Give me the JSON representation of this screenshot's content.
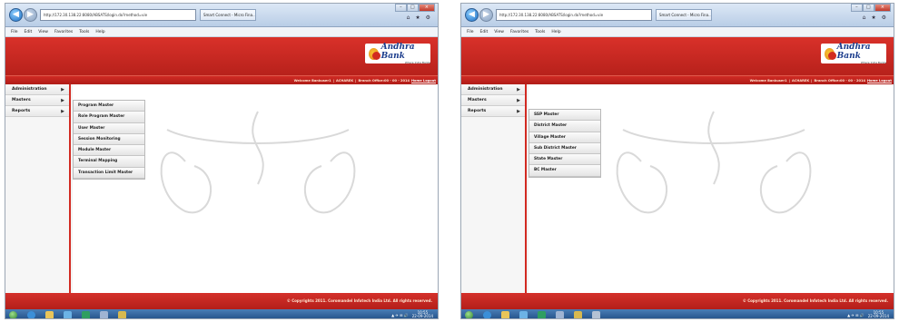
{
  "browser": {
    "address": "http://172.30.138.22:8080/ABSATS/login.do?method=vie",
    "tab_title": "Smart Connect - Micro Fina...",
    "menu": [
      "File",
      "Edit",
      "View",
      "Favorites",
      "Tools",
      "Help"
    ]
  },
  "header": {
    "logo_name": "Andhra Bank",
    "logo_tagline": "Where India Banks"
  },
  "welcome": {
    "greeting": "Welcome Bankuser1",
    "user_id": "ACHAREK",
    "branch": "Branch Office:00 - 00 - 2014",
    "logout": "Home Logout"
  },
  "sidebar": {
    "items": [
      {
        "label": "Administration"
      },
      {
        "label": "Masters"
      },
      {
        "label": "Reports"
      }
    ]
  },
  "panels": [
    {
      "submenu": [
        "Program Master",
        "Role Program Master",
        "User Master",
        "Session Monitoring",
        "Module Master",
        "Terminal Mapping",
        "Transaction Limit Master"
      ]
    },
    {
      "submenu": [
        "SSP Master",
        "District Master",
        "Village Master",
        "Sub District Master",
        "State Master",
        "BC Master"
      ]
    }
  ],
  "footer": {
    "copyright": "© Copyrights 2011. Coromandel Infotech India Ltd. All rights reserved."
  },
  "taskbar": {
    "time": "10:55",
    "date": "22-09-2014"
  },
  "colors": {
    "brand_red": "#c4261f",
    "logo_blue": "#1b3c8c",
    "taskbar_blue": "#2d5f98"
  }
}
